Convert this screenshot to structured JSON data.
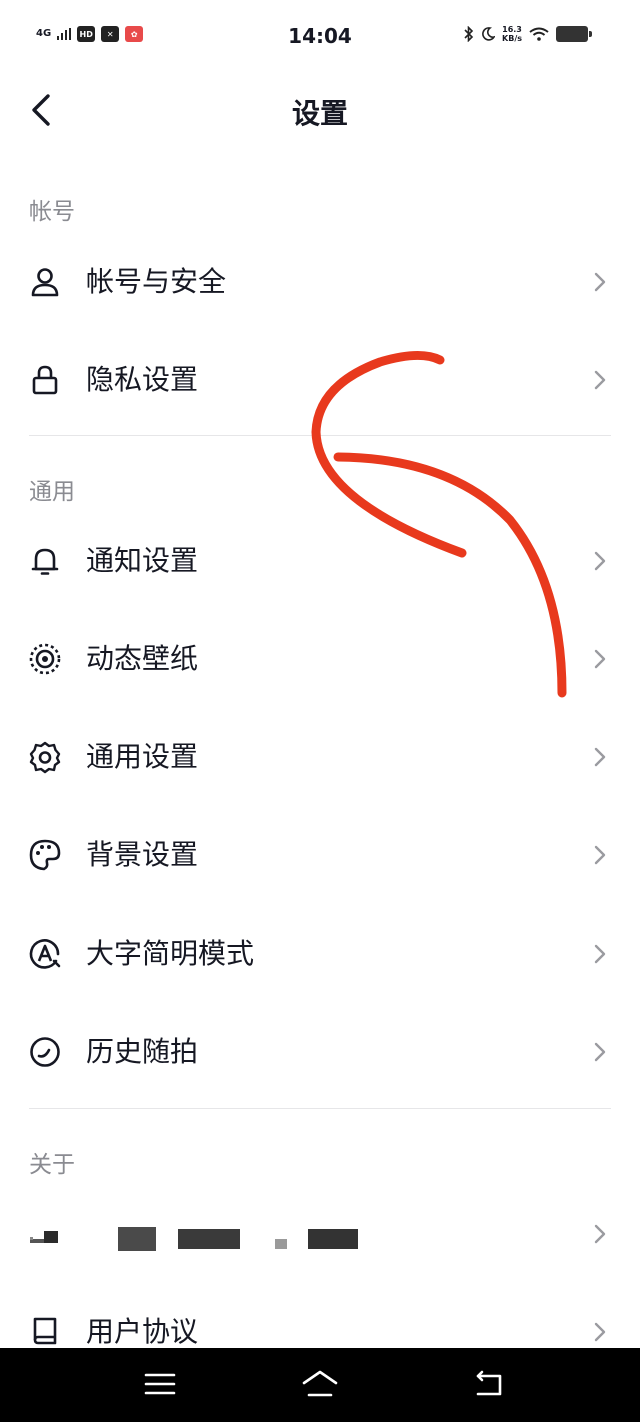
{
  "status_bar": {
    "signal": "4G",
    "hd_badge": "HD",
    "time": "14:04",
    "net_speed_value": "16.3",
    "net_speed_unit": "KB/s"
  },
  "header": {
    "title": "设置"
  },
  "sections": {
    "account": {
      "label": "帐号",
      "items": [
        {
          "label": "帐号与安全",
          "icon": "user-icon"
        },
        {
          "label": "隐私设置",
          "icon": "lock-icon"
        }
      ]
    },
    "general": {
      "label": "通用",
      "items": [
        {
          "label": "通知设置",
          "icon": "bell-icon"
        },
        {
          "label": "动态壁纸",
          "icon": "live-wallpaper-icon"
        },
        {
          "label": "通用设置",
          "icon": "gear-icon"
        },
        {
          "label": "背景设置",
          "icon": "palette-icon"
        },
        {
          "label": "大字简明模式",
          "icon": "large-font-icon"
        },
        {
          "label": "历史随拍",
          "icon": "history-icon"
        }
      ]
    },
    "about": {
      "label": "关于",
      "items": [
        {
          "label": "",
          "icon": "redacted-icon"
        },
        {
          "label": "用户协议",
          "icon": "book-icon"
        }
      ]
    }
  },
  "colors": {
    "text_primary": "#161823",
    "text_secondary": "#8a8b91",
    "divider": "#e6e6e8",
    "annotation_red": "#e8391d",
    "nav_bar": "#000000"
  }
}
